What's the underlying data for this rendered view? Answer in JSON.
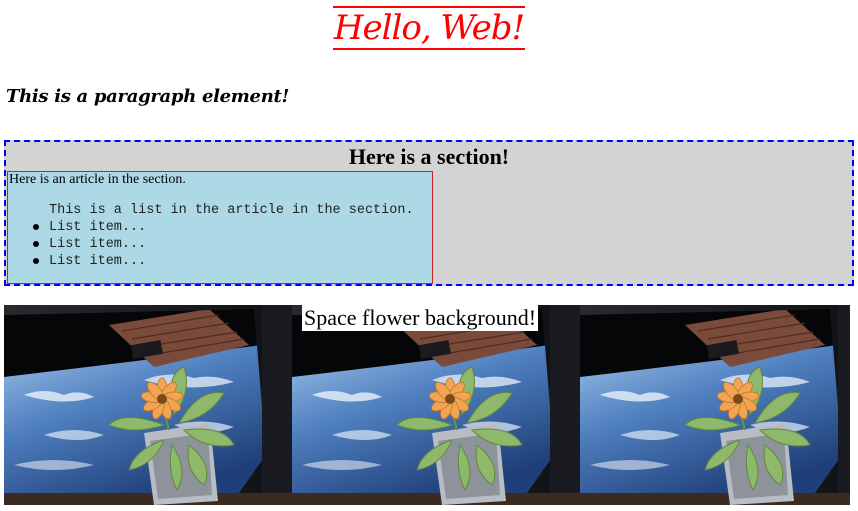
{
  "heading": {
    "text": "Hello, Web!",
    "color": "#ff0000"
  },
  "paragraph": {
    "text": "This is a paragraph element!"
  },
  "section": {
    "title": "Here is a section!",
    "background": "#d3d3d3",
    "border_color": "#0000ff",
    "article": {
      "text": "Here is an article in the section.",
      "background": "#add8e6",
      "list_caption": "This is a list in the article in the section.",
      "items": [
        "List item...",
        "List item...",
        "List item..."
      ]
    }
  },
  "banner": {
    "caption": "Space flower background!",
    "image": "space-flower-photo",
    "repeat_count": 3
  }
}
